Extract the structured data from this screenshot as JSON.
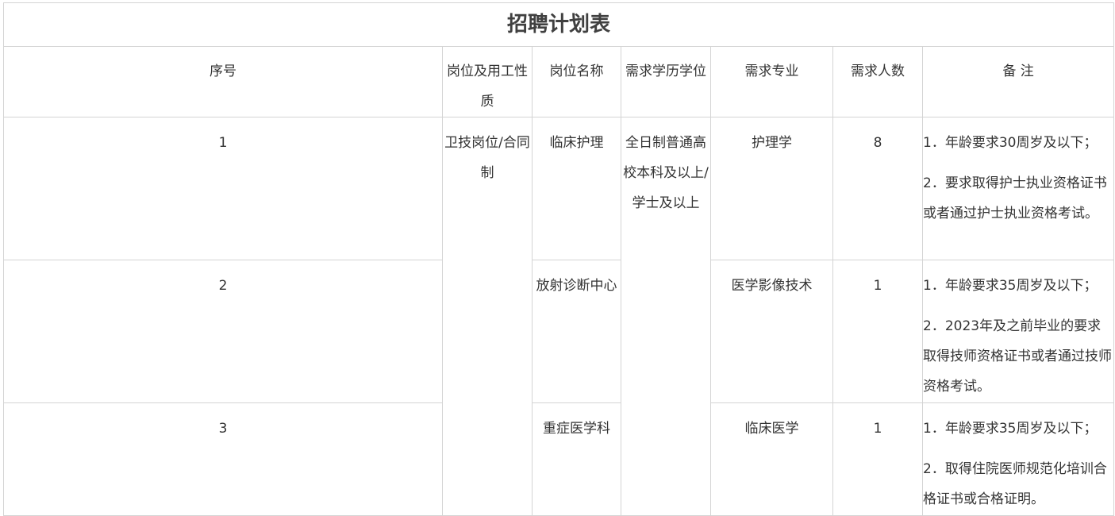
{
  "title": "招聘计划表",
  "headers": {
    "seq": "序号",
    "nature": "岗位及用工性质",
    "name": "岗位名称",
    "education": "需求学历学位",
    "major": "需求专业",
    "count": "需求人数",
    "notes": "备 注"
  },
  "nature_merged": "卫技岗位/合同制",
  "education_merged": "全日制普通高校本科及以上/学士及以上",
  "rows": [
    {
      "seq": "1",
      "name": "临床护理",
      "major": "护理学",
      "count": "8",
      "note1": "1．年龄要求30周岁及以下；",
      "note2": "2．要求取得护士执业资格证书或者通过护士执业资格考试。"
    },
    {
      "seq": "2",
      "name": "放射诊断中心",
      "major": "医学影像技术",
      "count": "1",
      "note1": "1．年龄要求35周岁及以下；",
      "note2": "2．2023年及之前毕业的要求取得技师资格证书或者通过技师资格考试。"
    },
    {
      "seq": "3",
      "name": "重症医学科",
      "major": "临床医学",
      "count": "1",
      "note1": "1．年龄要求35周岁及以下；",
      "note2": "2．取得住院医师规范化培训合格证书或合格证明。"
    }
  ]
}
